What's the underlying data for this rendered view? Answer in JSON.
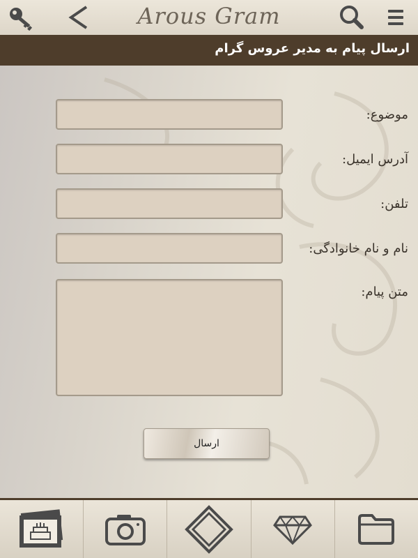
{
  "app": {
    "title": "Arous Gram"
  },
  "toolbar": {
    "icons": [
      "key-icon",
      "back-arrow-icon",
      "search-icon",
      "menu-icon"
    ]
  },
  "header": {
    "title": "ارسال پیام به مدیر عروس گرام"
  },
  "form": {
    "subject_label": "موضوع:",
    "subject_value": "",
    "email_label": "آدرس ایمیل:",
    "email_value": "",
    "phone_label": "تلفن:",
    "phone_value": "",
    "name_label": "نام و نام خانوادگی:",
    "name_value": "",
    "message_label": "متن پیام:",
    "message_value": "",
    "submit_label": "ارسال"
  },
  "bottom_nav": {
    "items": [
      "wedding-cake-photos-icon",
      "camera-icon",
      "diamond-shape-icon",
      "gem-icon",
      "folder-icon"
    ]
  },
  "colors": {
    "brand_dark": "#4e3d2b",
    "field_bg": "#ddd1c1",
    "field_border": "#a49a8b"
  }
}
